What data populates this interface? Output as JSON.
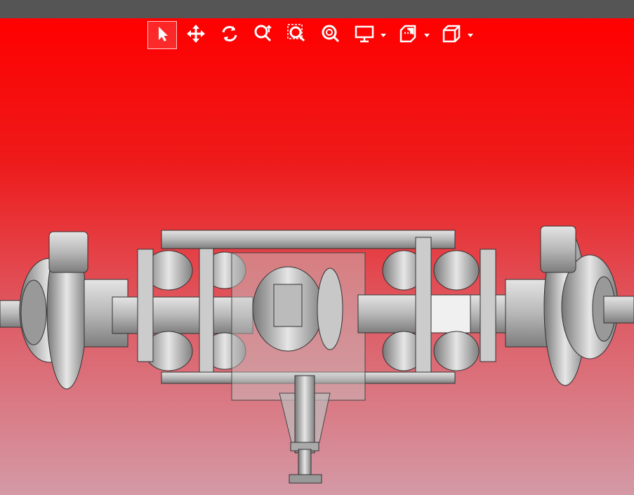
{
  "app": {
    "title": ""
  },
  "toolbar": {
    "tools": [
      {
        "id": "select",
        "icon": "select-arrow-icon",
        "active": true
      },
      {
        "id": "pan",
        "icon": "pan-move-icon",
        "active": false
      },
      {
        "id": "rotate",
        "icon": "rotate-icon",
        "active": false
      },
      {
        "id": "zoom",
        "icon": "zoom-icon",
        "active": false
      },
      {
        "id": "zoom-window",
        "icon": "zoom-window-icon",
        "active": false
      },
      {
        "id": "zoom-fit",
        "icon": "zoom-fit-icon",
        "active": false
      },
      {
        "id": "display-mode",
        "icon": "monitor-icon",
        "dropdown": true
      },
      {
        "id": "section",
        "icon": "section-cut-icon",
        "dropdown": true
      },
      {
        "id": "view-orientation",
        "icon": "cube-view-icon",
        "dropdown": true
      }
    ]
  },
  "viewport": {
    "background_top": "#ff0000",
    "background_bottom": "#d49aa6",
    "model": "axle-assembly-3d-model"
  }
}
